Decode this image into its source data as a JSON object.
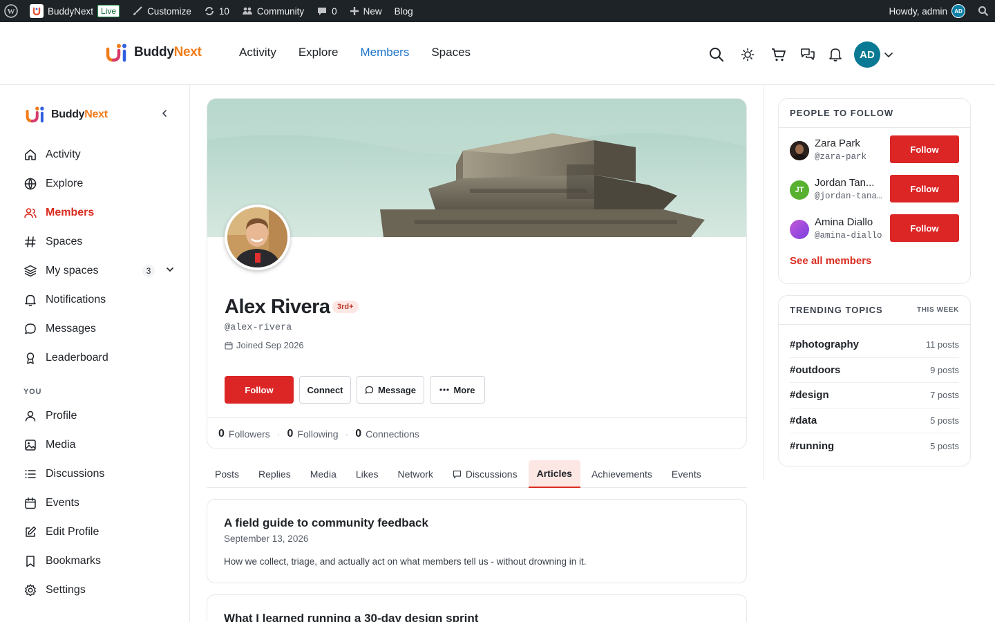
{
  "admin_bar": {
    "site_name": "BuddyNext",
    "live_label": "Live",
    "customize_label": "Customize",
    "updates_count": "10",
    "community_label": "Community",
    "comments_count": "0",
    "new_label": "New",
    "blog_label": "Blog",
    "howdy_label": "Howdy, admin",
    "avatar_initials": "AD"
  },
  "brand": {
    "part1": "Buddy",
    "part2": "Next"
  },
  "main_nav": [
    {
      "label": "Activity",
      "active": false
    },
    {
      "label": "Explore",
      "active": false
    },
    {
      "label": "Members",
      "active": true
    },
    {
      "label": "Spaces",
      "active": false
    }
  ],
  "header": {
    "avatar_initials": "AD"
  },
  "sidebar": {
    "items": [
      {
        "label": "Activity",
        "icon": "home-icon"
      },
      {
        "label": "Explore",
        "icon": "globe-icon"
      },
      {
        "label": "Members",
        "icon": "users-icon",
        "active": true
      },
      {
        "label": "Spaces",
        "icon": "hash-icon"
      },
      {
        "label": "My spaces",
        "icon": "layers-icon",
        "badge": "3"
      },
      {
        "label": "Notifications",
        "icon": "bell-icon"
      },
      {
        "label": "Messages",
        "icon": "chat-icon"
      },
      {
        "label": "Leaderboard",
        "icon": "award-icon"
      }
    ],
    "you_label": "YOU",
    "you_items": [
      {
        "label": "Profile",
        "icon": "user-icon"
      },
      {
        "label": "Media",
        "icon": "image-icon"
      },
      {
        "label": "Discussions",
        "icon": "list-icon"
      },
      {
        "label": "Events",
        "icon": "calendar-icon"
      },
      {
        "label": "Edit Profile",
        "icon": "edit-icon"
      },
      {
        "label": "Bookmarks",
        "icon": "bookmark-icon"
      },
      {
        "label": "Settings",
        "icon": "gear-icon"
      }
    ]
  },
  "profile": {
    "name": "Alex Rivera",
    "degree_badge": "3rd+",
    "handle": "@alex-rivera",
    "joined": "Joined Sep 2026",
    "actions": {
      "follow": "Follow",
      "connect": "Connect",
      "message": "Message",
      "more": "More"
    },
    "stats": [
      {
        "count": "0",
        "label": "Followers"
      },
      {
        "count": "0",
        "label": "Following"
      },
      {
        "count": "0",
        "label": "Connections"
      }
    ]
  },
  "tabs": [
    {
      "label": "Posts"
    },
    {
      "label": "Replies"
    },
    {
      "label": "Media"
    },
    {
      "label": "Likes"
    },
    {
      "label": "Network"
    },
    {
      "label": "Discussions",
      "icon": "comment-icon"
    },
    {
      "label": "Articles",
      "active": true
    },
    {
      "label": "Achievements"
    },
    {
      "label": "Events"
    }
  ],
  "articles": [
    {
      "title": "A field guide to community feedback",
      "date": "September 13, 2026",
      "excerpt": "How we collect, triage, and actually act on what members tell us - without drowning in it."
    },
    {
      "title": "What I learned running a 30-day design sprint",
      "date": "",
      "excerpt": ""
    }
  ],
  "people_to_follow": {
    "title": "PEOPLE TO FOLLOW",
    "people": [
      {
        "name": "Zara Park",
        "handle": "@zara-park",
        "avatar": "photo",
        "button": "Follow"
      },
      {
        "name": "Jordan Tan...",
        "handle": "@jordan-tana…",
        "avatar_initials": "JT",
        "avatar_color": "#58b02f",
        "button": "Follow"
      },
      {
        "name": "Amina Diallo",
        "handle": "@amina-diallo",
        "avatar": "gradient",
        "button": "Follow"
      }
    ],
    "see_all": "See all members"
  },
  "trending": {
    "title": "TRENDING TOPICS",
    "subtitle": "THIS WEEK",
    "topics": [
      {
        "tag": "#photography",
        "count": "11 posts"
      },
      {
        "tag": "#outdoors",
        "count": "9 posts"
      },
      {
        "tag": "#design",
        "count": "7 posts"
      },
      {
        "tag": "#data",
        "count": "5 posts"
      },
      {
        "tag": "#running",
        "count": "5 posts"
      }
    ]
  },
  "colors": {
    "accent_red": "#dc2626",
    "active_nav_blue": "#1d74c9",
    "brand_orange": "#f07c1a",
    "admin_bar": "#1d2327"
  }
}
